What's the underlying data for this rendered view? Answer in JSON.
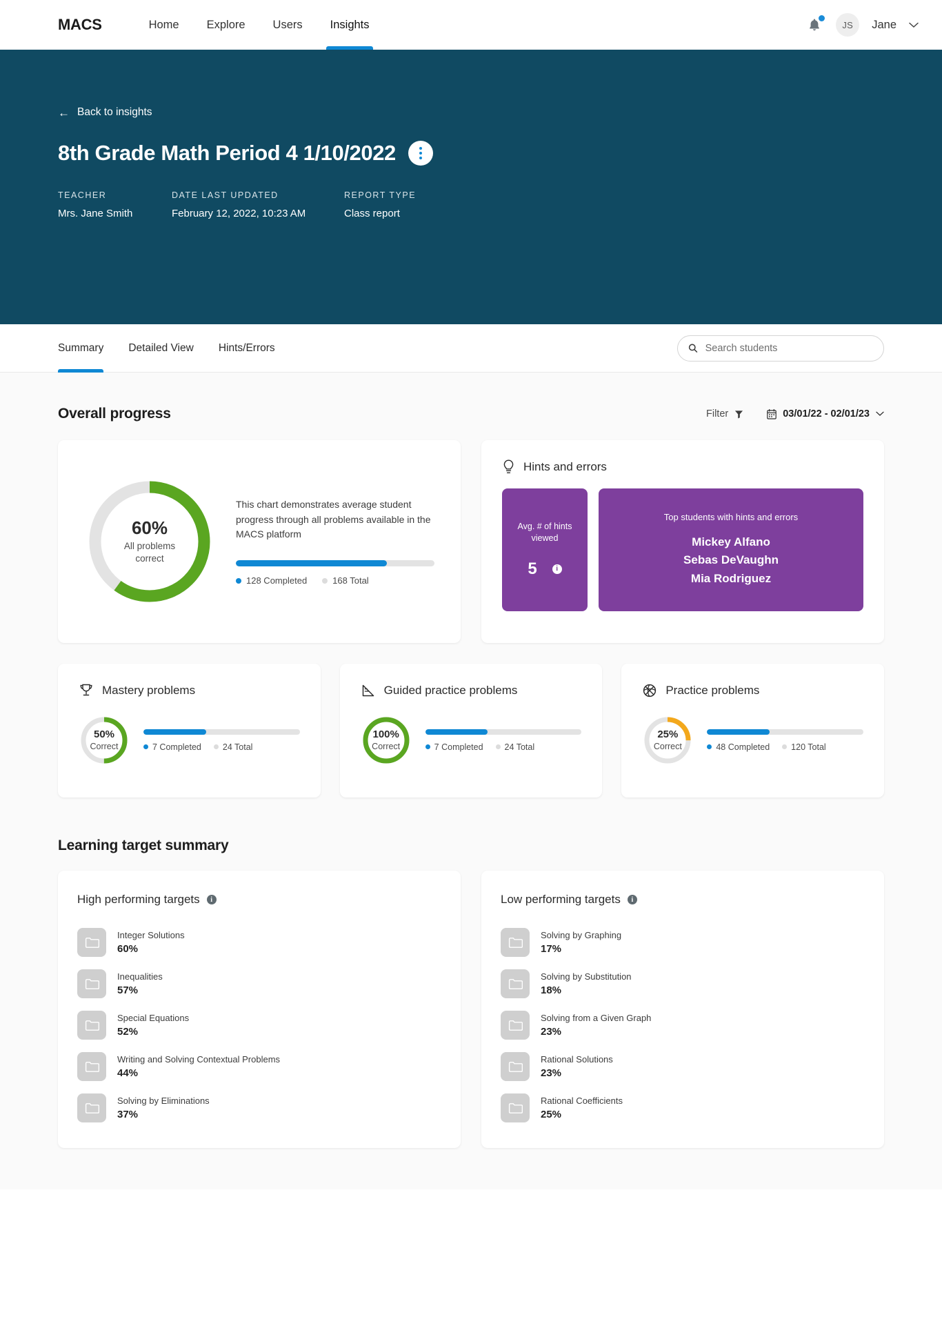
{
  "nav": {
    "brand": "MACS",
    "links": [
      {
        "label": "Home",
        "active": false
      },
      {
        "label": "Explore",
        "active": false
      },
      {
        "label": "Users",
        "active": false
      },
      {
        "label": "Insights",
        "active": true
      }
    ],
    "notification_icon": "bell-icon",
    "avatar_initials": "JS",
    "username": "Jane",
    "chevron": "⌄"
  },
  "hero": {
    "back_label": "Back to insights",
    "back_arrow": "←",
    "title": "8th Grade Math Period 4 1/10/2022",
    "menu_icon": "kebab-menu-icon",
    "meta": [
      {
        "label": "TEACHER",
        "value": "Mrs. Jane Smith"
      },
      {
        "label": "DATE LAST UPDATED",
        "value": "February 12, 2022, 10:23 AM"
      },
      {
        "label": "REPORT TYPE",
        "value": "Class report"
      }
    ],
    "background_color": "#104a62"
  },
  "tabs": [
    {
      "label": "Summary",
      "active": true
    },
    {
      "label": "Detailed View",
      "active": false
    },
    {
      "label": "Hints/Errors",
      "active": false
    }
  ],
  "search": {
    "placeholder": "Search students",
    "value": "",
    "icon": "search-icon"
  },
  "overall": {
    "title": "Overall progress",
    "filter_label": "Filter",
    "filter_icon": "funnel-icon",
    "date_range": "03/01/22 - 02/01/23",
    "calendar_icon": "calendar-icon",
    "chevron": "⌄"
  },
  "progress_card": {
    "percent_text": "60%",
    "percent_value": 60,
    "sub_line1": "All problems",
    "sub_line2": "correct",
    "description": "This chart demonstrates average student progress through all problems available in the MACS platform",
    "bar_percent": 76,
    "legend_completed": "128 Completed",
    "legend_total": "168 Total",
    "arc_color": "#5aa621",
    "track_color": "#e3e3e3"
  },
  "hints_card": {
    "icon": "lightbulb-icon",
    "title": "Hints and errors",
    "avg_label": "Avg. # of hints viewed",
    "avg_value": "5",
    "info_icon": "info-icon",
    "top_label": "Top students with hints and errors",
    "students": [
      "Mickey Alfano",
      "Sebas DeVaughn",
      "Mia Rodriguez"
    ],
    "tile_color": "#7e3f9d"
  },
  "small_cards": [
    {
      "icon": "trophy-icon",
      "title": "Mastery problems",
      "percent_text": "50%",
      "percent_value": 50,
      "sub": "Correct",
      "arc_color": "#5aa621",
      "bar_percent": 40,
      "legend_completed": "7 Completed",
      "legend_total": "24 Total"
    },
    {
      "icon": "ruler-icon",
      "title": "Guided practice problems",
      "percent_text": "100%",
      "percent_value": 100,
      "sub": "Correct",
      "arc_color": "#5aa621",
      "bar_percent": 40,
      "legend_completed": "7 Completed",
      "legend_total": "24 Total"
    },
    {
      "icon": "basketball-icon",
      "title": "Practice problems",
      "percent_text": "25%",
      "percent_value": 25,
      "sub": "Correct",
      "arc_color": "#f3a81c",
      "bar_percent": 40,
      "legend_completed": "48 Completed",
      "legend_total": "120 Total"
    }
  ],
  "learning": {
    "section_title": "Learning target summary",
    "high": {
      "title": "High performing targets",
      "info_icon": "info-icon",
      "items": [
        {
          "name": "Integer Solutions",
          "pct": "60%"
        },
        {
          "name": "Inequalities",
          "pct": "57%"
        },
        {
          "name": "Special Equations",
          "pct": "52%"
        },
        {
          "name": "Writing and Solving Contextual Problems",
          "pct": "44%"
        },
        {
          "name": "Solving by Eliminations",
          "pct": "37%"
        }
      ]
    },
    "low": {
      "title": "Low performing targets",
      "info_icon": "info-icon",
      "items": [
        {
          "name": "Solving by Graphing",
          "pct": "17%"
        },
        {
          "name": "Solving by Substitution",
          "pct": "18%"
        },
        {
          "name": "Solving from a Given Graph",
          "pct": "23%"
        },
        {
          "name": "Rational Solutions",
          "pct": "23%"
        },
        {
          "name": "Rational Coefficients",
          "pct": "25%"
        }
      ]
    }
  },
  "chart_data": {
    "type": "pie",
    "title": "Overall progress donuts",
    "charts": [
      {
        "name": "All problems correct",
        "value": 60,
        "max": 100,
        "color": "#5aa621",
        "bar": {
          "completed": 128,
          "total": 168
        }
      },
      {
        "name": "Mastery problems",
        "value": 50,
        "max": 100,
        "color": "#5aa621",
        "bar": {
          "completed": 7,
          "total": 24
        }
      },
      {
        "name": "Guided practice problems",
        "value": 100,
        "max": 100,
        "color": "#5aa621",
        "bar": {
          "completed": 7,
          "total": 24
        }
      },
      {
        "name": "Practice problems",
        "value": 25,
        "max": 100,
        "color": "#f3a81c",
        "bar": {
          "completed": 48,
          "total": 120
        }
      }
    ],
    "high_performing_targets": {
      "categories": [
        "Integer Solutions",
        "Inequalities",
        "Special Equations",
        "Writing and Solving Contextual Problems",
        "Solving by Eliminations"
      ],
      "values": [
        60,
        57,
        52,
        44,
        37
      ]
    },
    "low_performing_targets": {
      "categories": [
        "Solving by Graphing",
        "Solving by Substitution",
        "Solving from a Given Graph",
        "Rational Solutions",
        "Rational Coefficients"
      ],
      "values": [
        17,
        18,
        23,
        23,
        25
      ]
    }
  }
}
